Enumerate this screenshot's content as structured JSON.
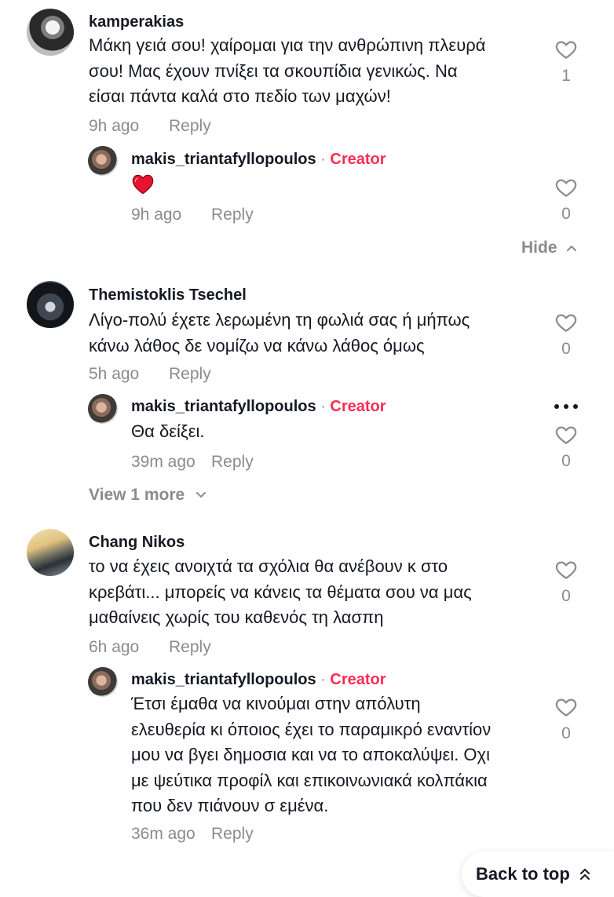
{
  "comments": [
    {
      "username": "kamperakias",
      "text_lines": [
        "Μάκη γειά σου! χαίρομαι για την ανθρώπινη πλευρά",
        "σου! Μας έχουν πνίξει τα σκουπίδια γενικώς. Να",
        "είσαι πάντα καλά στο πεδίο των μαχών!"
      ],
      "time": "9h ago",
      "reply_label": "Reply",
      "likes": "1",
      "reply": {
        "username": "makis_triantafyllopoulos",
        "separator": "·",
        "badge": "Creator",
        "emoji": "heart-emoji",
        "time": "9h ago",
        "reply_label": "Reply",
        "likes": "0"
      },
      "toggle_label": "Hide"
    },
    {
      "username": "Themistoklis Tsechel",
      "text_lines": [
        "Λίγο-πολύ έχετε λερωμένη τη φωλιά σας ή μήπως",
        "κάνω λάθος δε νομίζω να κάνω λάθος όμως"
      ],
      "time": "5h ago",
      "reply_label": "Reply",
      "likes": "0",
      "reply": {
        "username": "makis_triantafyllopoulos",
        "separator": "·",
        "badge": "Creator",
        "text_lines": [
          "Θα δείξει."
        ],
        "time": "39m ago",
        "reply_label": "Reply",
        "likes": "0",
        "more_icon": "ellipsis-icon"
      },
      "toggle_label": "View 1 more"
    },
    {
      "username": "Chang Nikos",
      "text_lines": [
        "το να έχεις ανοιχτά τα σχόλια θα ανέβουν κ στο",
        "κρεβάτι... μπορείς να κάνεις τα θέματα σου να μας",
        "μαθαίνεις χωρίς του καθενός τη λασπη"
      ],
      "time": "6h ago",
      "reply_label": "Reply",
      "likes": "0",
      "reply": {
        "username": "makis_triantafyllopoulos",
        "separator": "·",
        "badge": "Creator",
        "text_lines": [
          "Έτσι έμαθα να κινούμαι στην απόλυτη",
          "ελευθερία κι όποιος έχει το παραμικρό εναντίον",
          "μου να βγει δημοσια και να το αποκαλύψει. Οχι",
          "με ψεύτικα προφίλ και επικοινωνιακά κολπάκια",
          "που δεν πιάνουν σ εμένα."
        ],
        "time": "36m ago",
        "reply_label": "Reply",
        "likes": "0"
      }
    }
  ],
  "back_to_top_label": "Back to top",
  "colors": {
    "creator": "#fe2c55",
    "muted": "#8a8b91",
    "text": "#161823"
  }
}
